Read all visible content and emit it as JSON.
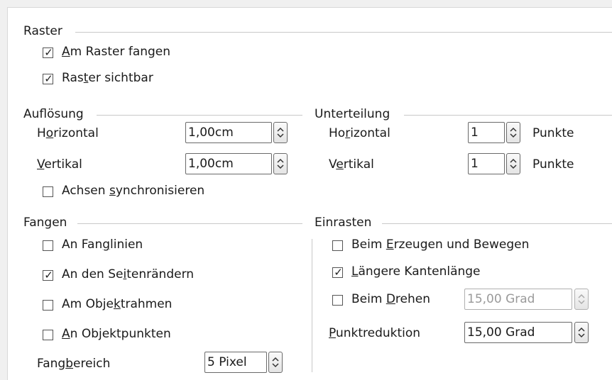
{
  "raster": {
    "title": "Raster",
    "snap_to_grid": {
      "pre": "",
      "ul": "A",
      "post": "m Raster fangen",
      "checked": true
    },
    "grid_visible": {
      "pre": "Ras",
      "ul": "t",
      "post": "er sichtbar",
      "checked": true
    }
  },
  "resolution": {
    "title": "Auflösung",
    "horizontal": {
      "pre": "H",
      "ul": "o",
      "post": "rizontal",
      "value": "1,00cm"
    },
    "vertical": {
      "pre": "",
      "ul": "V",
      "post": "ertikal",
      "value": "1,00cm"
    },
    "sync_axes": {
      "pre": "Achsen ",
      "ul": "s",
      "post": "ynchronisieren",
      "checked": false
    }
  },
  "subdivision": {
    "title": "Unterteilung",
    "horizontal": {
      "pre": "Ho",
      "ul": "r",
      "post": "izontal",
      "value": "1",
      "unit": "Punkte"
    },
    "vertical": {
      "pre": "V",
      "ul": "e",
      "post": "rtikal",
      "value": "1",
      "unit": "Punkte"
    }
  },
  "snap": {
    "title": "Fangen",
    "snap_lines": {
      "pre": "An Fan",
      "ul": "g",
      "post": "linien",
      "checked": false
    },
    "page_margins": {
      "pre": "An den Se",
      "ul": "i",
      "post": "tenrändern",
      "checked": true
    },
    "object_frame": {
      "pre": "Am Obje",
      "ul": "k",
      "post": "trahmen",
      "checked": false
    },
    "object_points": {
      "pre": "",
      "ul": "A",
      "post": "n Objektpunkten",
      "checked": false
    },
    "snap_range": {
      "pre": "Fang",
      "ul": "b",
      "post": "ereich",
      "value": "5 Pixel"
    }
  },
  "constrain": {
    "title": "Einrasten",
    "create_move": {
      "pre": "Beim ",
      "ul": "E",
      "post": "rzeugen und Bewegen",
      "checked": false
    },
    "longer_edge": {
      "pre": "",
      "ul": "L",
      "post": "ängere Kantenlänge",
      "checked": true
    },
    "rotate": {
      "pre": "Beim ",
      "ul": "D",
      "post": "rehen",
      "checked": false,
      "value": "15,00 Grad"
    },
    "point_reduction": {
      "pre": "",
      "ul": "P",
      "post": "unktreduktion",
      "value": "15,00 Grad"
    }
  }
}
